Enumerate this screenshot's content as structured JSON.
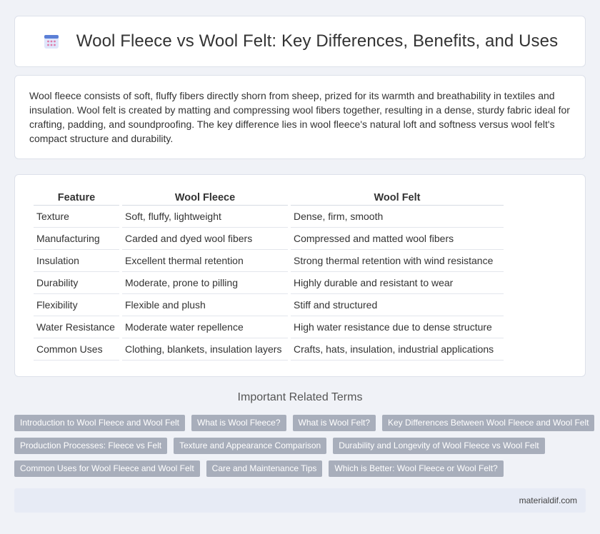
{
  "header": {
    "icon": "document-table-icon",
    "title": "Wool Fleece vs Wool Felt: Key Differences, Benefits, and Uses"
  },
  "intro": {
    "text": "Wool fleece consists of soft, fluffy fibers directly shorn from sheep, prized for its warmth and breathability in textiles and insulation. Wool felt is created by matting and compressing wool fibers together, resulting in a dense, sturdy fabric ideal for crafting, padding, and soundproofing. The key difference lies in wool fleece's natural loft and softness versus wool felt's compact structure and durability."
  },
  "table": {
    "headers": [
      "Feature",
      "Wool Fleece",
      "Wool Felt"
    ],
    "rows": [
      [
        "Texture",
        "Soft, fluffy, lightweight",
        "Dense, firm, smooth"
      ],
      [
        "Manufacturing",
        "Carded and dyed wool fibers",
        "Compressed and matted wool fibers"
      ],
      [
        "Insulation",
        "Excellent thermal retention",
        "Strong thermal retention with wind resistance"
      ],
      [
        "Durability",
        "Moderate, prone to pilling",
        "Highly durable and resistant to wear"
      ],
      [
        "Flexibility",
        "Flexible and plush",
        "Stiff and structured"
      ],
      [
        "Water Resistance",
        "Moderate water repellence",
        "High water resistance due to dense structure"
      ],
      [
        "Common Uses",
        "Clothing, blankets, insulation layers",
        "Crafts, hats, insulation, industrial applications"
      ]
    ]
  },
  "related": {
    "title": "Important Related Terms",
    "rows": [
      [
        "Introduction to Wool Fleece and Wool Felt",
        "What is Wool Fleece?",
        "What is Wool Felt?",
        "Key Differences Between Wool Fleece and Wool Felt"
      ],
      [
        "Production Processes: Fleece vs Felt",
        "Texture and Appearance Comparison",
        "Durability and Longevity of Wool Fleece vs Wool Felt"
      ],
      [
        "Common Uses for Wool Fleece and Wool Felt",
        "Care and Maintenance Tips",
        "Which is Better: Wool Fleece or Wool Felt?"
      ]
    ]
  },
  "footer": {
    "site": "materialdif.com"
  },
  "colors": {
    "background": "#f0f2f7",
    "tag": "#a8aebb",
    "footer": "#e7ebf5",
    "icon_blue": "#5b7fd6",
    "icon_pink": "#e07aa8"
  }
}
